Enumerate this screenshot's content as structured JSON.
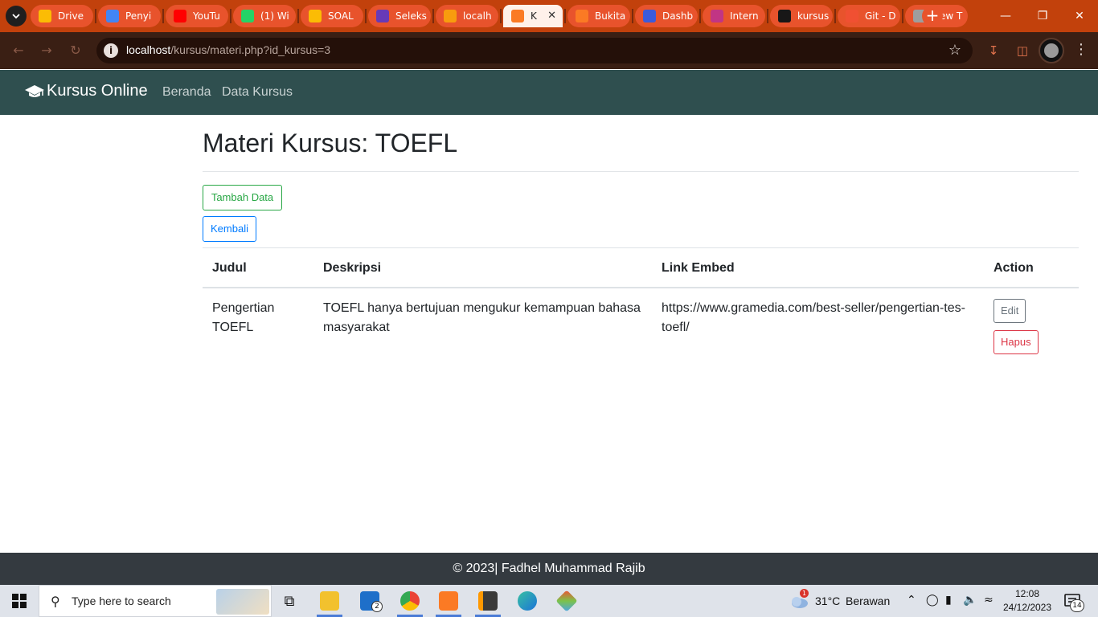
{
  "browser": {
    "tabs": [
      {
        "label": "Drive",
        "icon": "google-drive-icon",
        "color": "#fbbc04"
      },
      {
        "label": "Penyi",
        "icon": "google-ads-icon",
        "color": "#4285f4"
      },
      {
        "label": "YouTu",
        "icon": "youtube-icon",
        "color": "#ff0000"
      },
      {
        "label": "(1) Wi",
        "icon": "whatsapp-icon",
        "color": "#25d366"
      },
      {
        "label": "SOAL",
        "icon": "google-drive-icon",
        "color": "#fbbc04"
      },
      {
        "label": "Seleks",
        "icon": "google-forms-icon",
        "color": "#673ab7"
      },
      {
        "label": "localh",
        "icon": "phpmyadmin-icon",
        "color": "#f89c0e"
      },
      {
        "label": "K",
        "icon": "xampp-icon",
        "color": "#fb7a24",
        "active": true
      },
      {
        "label": "Bukita",
        "icon": "xampp-icon",
        "color": "#fb7a24"
      },
      {
        "label": "Dashb",
        "icon": "dashboard-icon",
        "color": "#3b5bdb"
      },
      {
        "label": "Intern",
        "icon": "instagram-icon",
        "color": "#c13584"
      },
      {
        "label": "kursus",
        "icon": "github-icon",
        "color": "#181717"
      },
      {
        "label": "Git - D",
        "icon": "git-icon",
        "color": "#f05032"
      },
      {
        "label": "New T",
        "icon": "chrome-icon",
        "color": "#9e9e9e"
      }
    ],
    "url_host": "localhost",
    "url_path": "/kursus/materi.php?id_kursus=3"
  },
  "site": {
    "brand": "Kursus Online",
    "nav": {
      "home": "Beranda",
      "courses": "Data Kursus"
    }
  },
  "main": {
    "title": "Materi Kursus: TOEFL",
    "add_label": "Tambah Data",
    "back_label": "Kembali",
    "table": {
      "headers": [
        "Judul",
        "Deskripsi",
        "Link Embed",
        "Action"
      ],
      "rows": [
        {
          "judul_line1": "Pengertian",
          "judul_line2": "TOEFL",
          "deskripsi_line1": "TOEFL hanya bertujuan mengukur kemampuan bahasa",
          "deskripsi_line2": "masyarakat",
          "link_line1": "https://www.gramedia.com/best-seller/pengertian-tes-",
          "link_line2": "toefl/",
          "edit_label": "Edit",
          "delete_label": "Hapus"
        }
      ]
    }
  },
  "footer": {
    "text": "© 2023| Fadhel Muhammad Rajib"
  },
  "taskbar": {
    "search_placeholder": "Type here to search",
    "mail_badge": "2",
    "weather_badge": "1",
    "temperature": "31°C",
    "weather": "Berawan",
    "time": "12:08",
    "date": "24/12/2023",
    "notifications": "14"
  }
}
